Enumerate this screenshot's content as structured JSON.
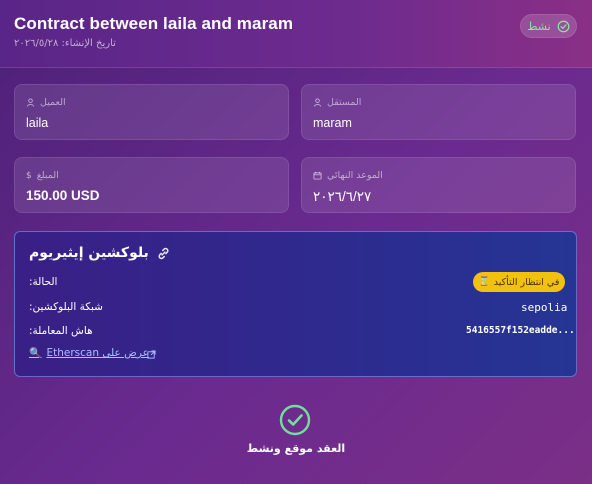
{
  "header": {
    "title": "Contract between laila and maram",
    "created_date": "تاريخ الإنشاء: ٢٠٢٦/٥/٢٨",
    "status_label": "نشط"
  },
  "parties": {
    "client_label": "العميل",
    "client_value": "laila",
    "freelancer_label": "المستقل",
    "freelancer_value": "maram"
  },
  "details": {
    "amount_label": "المبلغ",
    "amount_value": "150.00 USD",
    "deadline_label": "الموعد النهائي",
    "deadline_value": "٢٠٢٦/٦/٢٧"
  },
  "blockchain": {
    "title": "بلوكشين إيثيريوم",
    "status_label": "الحالة:",
    "status_value": "في انتظار التأكيد",
    "network_label": "شبكة البلوكشين:",
    "network_value": "sepolia",
    "hash_label": "هاش المعاملة:",
    "hash_value": "5416557f152eadde...",
    "etherscan_link": "عرض على Etherscan"
  },
  "footer": {
    "message": "العقد موقع ونشط"
  },
  "colors": {
    "accent_green": "#8ee6a6",
    "pending_yellow": "#f2c00f",
    "link_blue": "#aac0ff"
  },
  "icons": {
    "status": "check-circle-icon",
    "client": "user-icon",
    "freelancer": "user-icon",
    "amount": "dollar-icon",
    "deadline": "calendar-icon",
    "blockchain": "link-icon",
    "pending": "hourglass-icon",
    "etherscan": "search-icon",
    "external": "external-link-icon",
    "done": "check-circle-icon"
  }
}
